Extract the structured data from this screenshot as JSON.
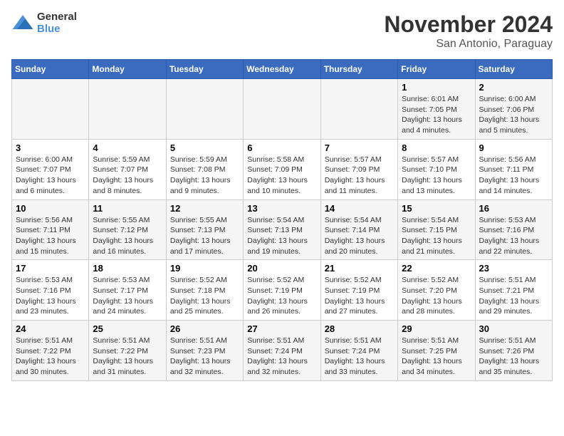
{
  "logo": {
    "general": "General",
    "blue": "Blue"
  },
  "title": "November 2024",
  "subtitle": "San Antonio, Paraguay",
  "weekdays": [
    "Sunday",
    "Monday",
    "Tuesday",
    "Wednesday",
    "Thursday",
    "Friday",
    "Saturday"
  ],
  "weeks": [
    [
      {
        "day": "",
        "info": ""
      },
      {
        "day": "",
        "info": ""
      },
      {
        "day": "",
        "info": ""
      },
      {
        "day": "",
        "info": ""
      },
      {
        "day": "",
        "info": ""
      },
      {
        "day": "1",
        "info": "Sunrise: 6:01 AM\nSunset: 7:05 PM\nDaylight: 13 hours and 4 minutes."
      },
      {
        "day": "2",
        "info": "Sunrise: 6:00 AM\nSunset: 7:06 PM\nDaylight: 13 hours and 5 minutes."
      }
    ],
    [
      {
        "day": "3",
        "info": "Sunrise: 6:00 AM\nSunset: 7:07 PM\nDaylight: 13 hours and 6 minutes."
      },
      {
        "day": "4",
        "info": "Sunrise: 5:59 AM\nSunset: 7:07 PM\nDaylight: 13 hours and 8 minutes."
      },
      {
        "day": "5",
        "info": "Sunrise: 5:59 AM\nSunset: 7:08 PM\nDaylight: 13 hours and 9 minutes."
      },
      {
        "day": "6",
        "info": "Sunrise: 5:58 AM\nSunset: 7:09 PM\nDaylight: 13 hours and 10 minutes."
      },
      {
        "day": "7",
        "info": "Sunrise: 5:57 AM\nSunset: 7:09 PM\nDaylight: 13 hours and 11 minutes."
      },
      {
        "day": "8",
        "info": "Sunrise: 5:57 AM\nSunset: 7:10 PM\nDaylight: 13 hours and 13 minutes."
      },
      {
        "day": "9",
        "info": "Sunrise: 5:56 AM\nSunset: 7:11 PM\nDaylight: 13 hours and 14 minutes."
      }
    ],
    [
      {
        "day": "10",
        "info": "Sunrise: 5:56 AM\nSunset: 7:11 PM\nDaylight: 13 hours and 15 minutes."
      },
      {
        "day": "11",
        "info": "Sunrise: 5:55 AM\nSunset: 7:12 PM\nDaylight: 13 hours and 16 minutes."
      },
      {
        "day": "12",
        "info": "Sunrise: 5:55 AM\nSunset: 7:13 PM\nDaylight: 13 hours and 17 minutes."
      },
      {
        "day": "13",
        "info": "Sunrise: 5:54 AM\nSunset: 7:13 PM\nDaylight: 13 hours and 19 minutes."
      },
      {
        "day": "14",
        "info": "Sunrise: 5:54 AM\nSunset: 7:14 PM\nDaylight: 13 hours and 20 minutes."
      },
      {
        "day": "15",
        "info": "Sunrise: 5:54 AM\nSunset: 7:15 PM\nDaylight: 13 hours and 21 minutes."
      },
      {
        "day": "16",
        "info": "Sunrise: 5:53 AM\nSunset: 7:16 PM\nDaylight: 13 hours and 22 minutes."
      }
    ],
    [
      {
        "day": "17",
        "info": "Sunrise: 5:53 AM\nSunset: 7:16 PM\nDaylight: 13 hours and 23 minutes."
      },
      {
        "day": "18",
        "info": "Sunrise: 5:53 AM\nSunset: 7:17 PM\nDaylight: 13 hours and 24 minutes."
      },
      {
        "day": "19",
        "info": "Sunrise: 5:52 AM\nSunset: 7:18 PM\nDaylight: 13 hours and 25 minutes."
      },
      {
        "day": "20",
        "info": "Sunrise: 5:52 AM\nSunset: 7:19 PM\nDaylight: 13 hours and 26 minutes."
      },
      {
        "day": "21",
        "info": "Sunrise: 5:52 AM\nSunset: 7:19 PM\nDaylight: 13 hours and 27 minutes."
      },
      {
        "day": "22",
        "info": "Sunrise: 5:52 AM\nSunset: 7:20 PM\nDaylight: 13 hours and 28 minutes."
      },
      {
        "day": "23",
        "info": "Sunrise: 5:51 AM\nSunset: 7:21 PM\nDaylight: 13 hours and 29 minutes."
      }
    ],
    [
      {
        "day": "24",
        "info": "Sunrise: 5:51 AM\nSunset: 7:22 PM\nDaylight: 13 hours and 30 minutes."
      },
      {
        "day": "25",
        "info": "Sunrise: 5:51 AM\nSunset: 7:22 PM\nDaylight: 13 hours and 31 minutes."
      },
      {
        "day": "26",
        "info": "Sunrise: 5:51 AM\nSunset: 7:23 PM\nDaylight: 13 hours and 32 minutes."
      },
      {
        "day": "27",
        "info": "Sunrise: 5:51 AM\nSunset: 7:24 PM\nDaylight: 13 hours and 32 minutes."
      },
      {
        "day": "28",
        "info": "Sunrise: 5:51 AM\nSunset: 7:24 PM\nDaylight: 13 hours and 33 minutes."
      },
      {
        "day": "29",
        "info": "Sunrise: 5:51 AM\nSunset: 7:25 PM\nDaylight: 13 hours and 34 minutes."
      },
      {
        "day": "30",
        "info": "Sunrise: 5:51 AM\nSunset: 7:26 PM\nDaylight: 13 hours and 35 minutes."
      }
    ]
  ]
}
